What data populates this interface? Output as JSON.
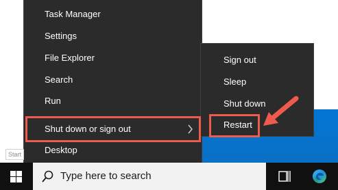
{
  "menu": {
    "items": [
      {
        "label": "Task Manager"
      },
      {
        "label": "Settings"
      },
      {
        "label": "File Explorer"
      },
      {
        "label": "Search"
      },
      {
        "label": "Run"
      },
      {
        "label": "Shut down or sign out"
      },
      {
        "label": "Desktop"
      }
    ]
  },
  "submenu": {
    "items": [
      {
        "label": "Sign out"
      },
      {
        "label": "Sleep"
      },
      {
        "label": "Shut down"
      },
      {
        "label": "Restart"
      }
    ]
  },
  "tooltip": {
    "label": "Start"
  },
  "taskbar": {
    "search_placeholder": "Type here to search",
    "icons": [
      "windows-logo-icon",
      "search-icon",
      "task-view-icon",
      "edge-icon"
    ]
  },
  "colors": {
    "highlight": "#ee5a4e",
    "menu_bg": "#2b2b2b",
    "desktop": "#0078d7",
    "taskbar": "#101010"
  }
}
